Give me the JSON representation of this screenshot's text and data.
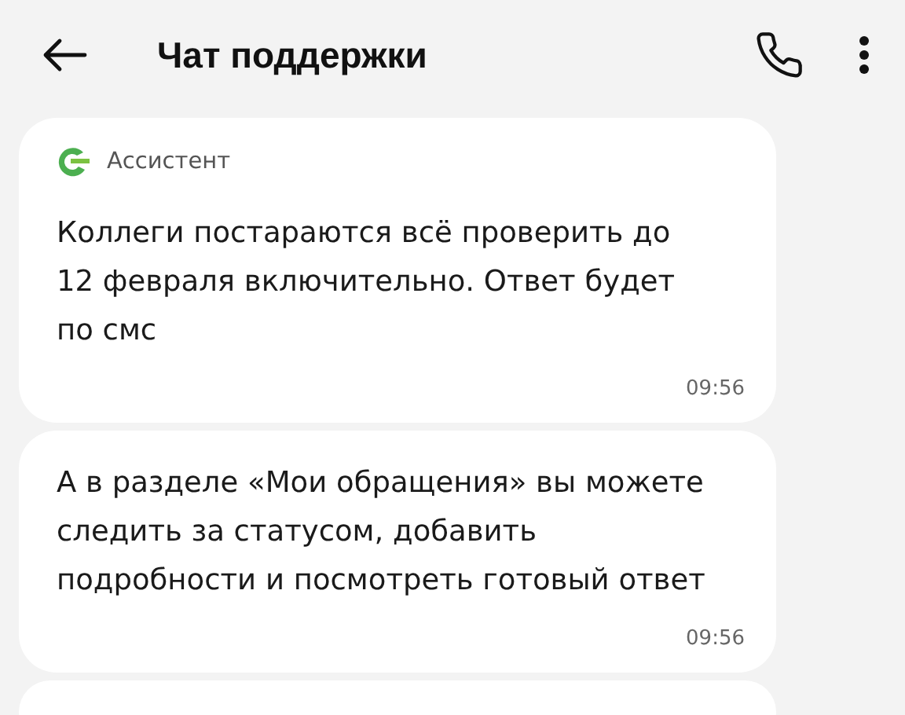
{
  "header": {
    "title": "Чат поддержки"
  },
  "messages": [
    {
      "sender": "Ассистент",
      "text": "Коллеги постараются всё проверить до 12 февраля включительно. Ответ будет по смс",
      "time": "09:56"
    },
    {
      "text": "А в разделе «Мои обращения» вы можете следить за статусом, добавить подробности и посмотреть готовый ответ",
      "time": "09:56"
    }
  ]
}
